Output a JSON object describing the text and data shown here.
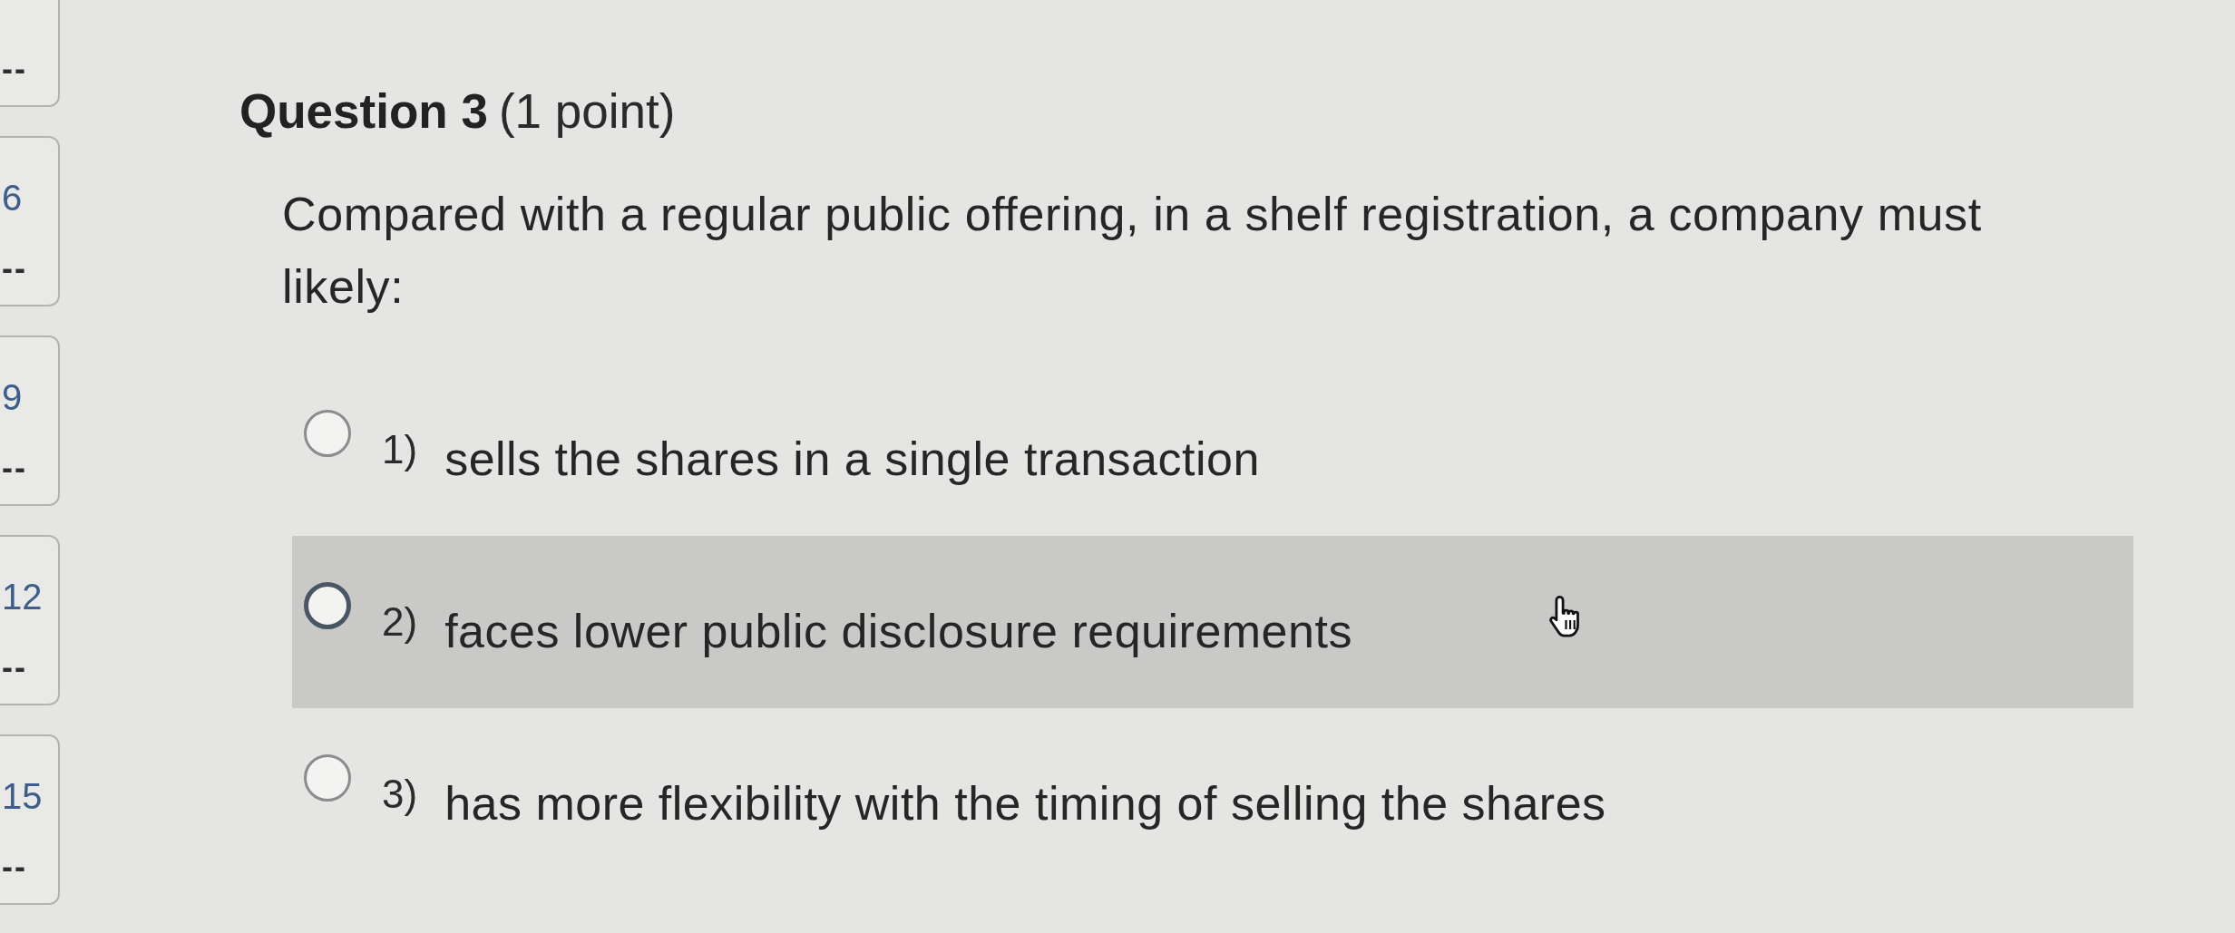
{
  "sidebar": {
    "tiles": [
      {
        "score": "--"
      },
      {
        "number": "6",
        "score": "--"
      },
      {
        "number": "9",
        "score": "--"
      },
      {
        "number": "12",
        "score": "--"
      },
      {
        "number": "15",
        "score": "--"
      }
    ]
  },
  "question": {
    "title": "Question 3",
    "points": "(1 point)",
    "text": "Compared with a regular public offering, in a shelf registration, a company must likely:"
  },
  "options": [
    {
      "number": "1)",
      "text": "sells the shares in a single transaction",
      "selected": false,
      "hovered": false
    },
    {
      "number": "2)",
      "text": "faces lower public disclosure requirements",
      "selected": false,
      "hovered": true
    },
    {
      "number": "3)",
      "text": "has more flexibility with the timing of selling the shares",
      "selected": false,
      "hovered": false
    }
  ]
}
